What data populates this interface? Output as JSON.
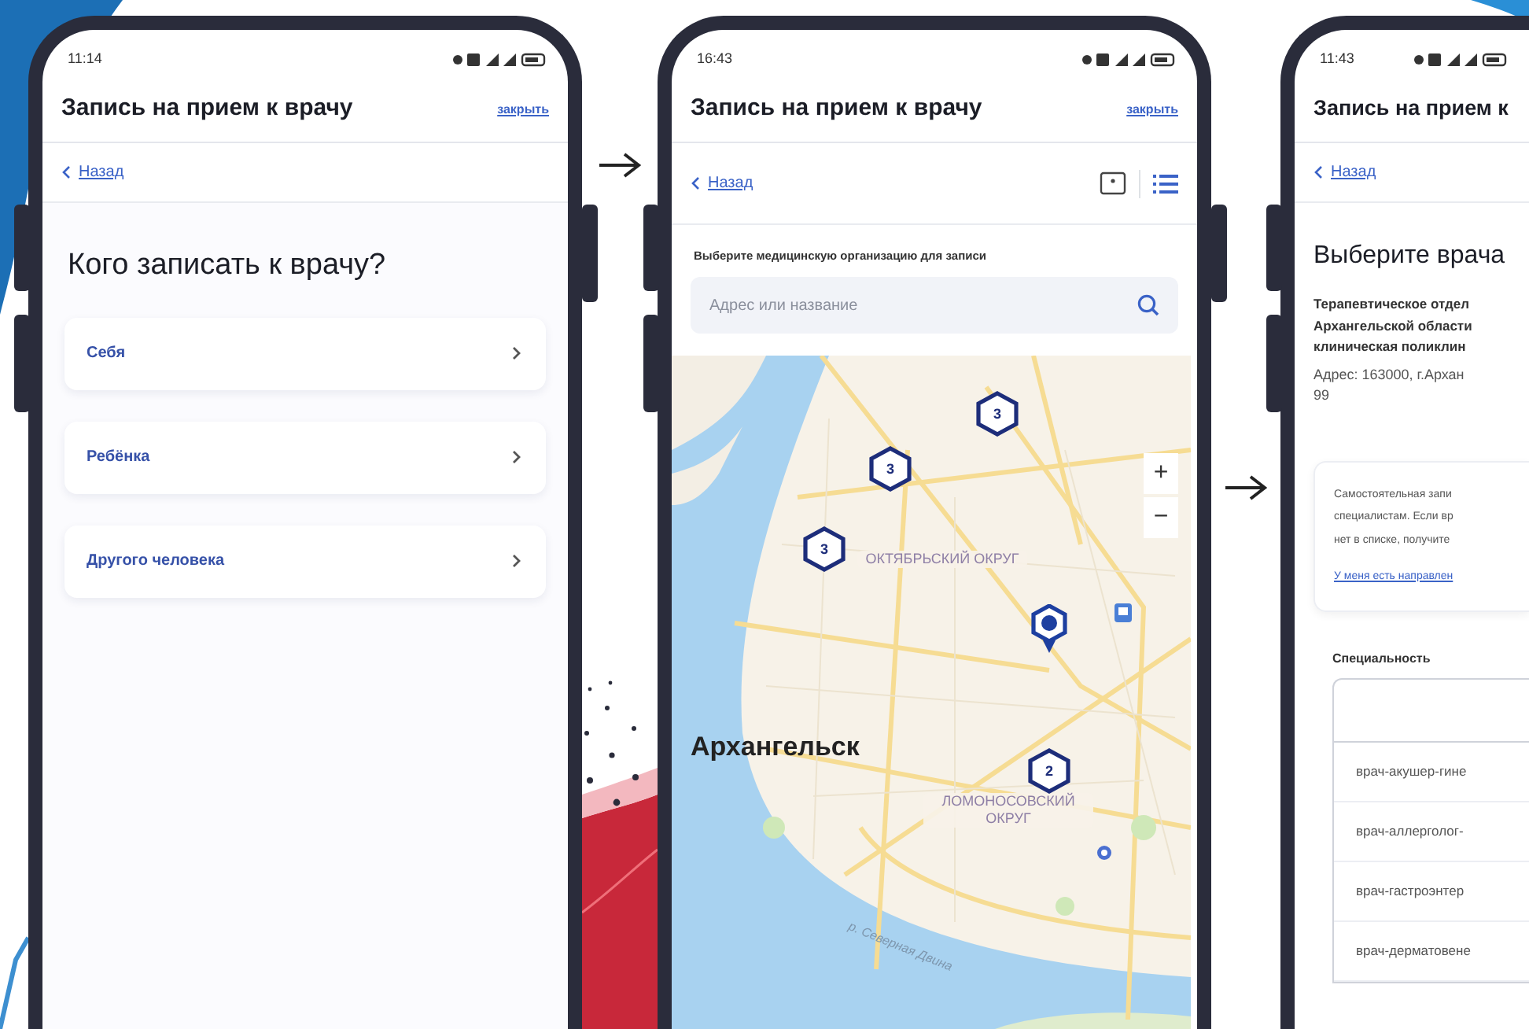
{
  "phones": [
    {
      "kind": "who",
      "status_time": "11:14",
      "title": "Запись на прием к врачу",
      "close": "закрыть",
      "back": "Назад",
      "heading": "Кого записать к врачу?",
      "options": [
        {
          "label": "Себя"
        },
        {
          "label": "Ребёнка"
        },
        {
          "label": "Другого человека"
        }
      ]
    },
    {
      "kind": "map",
      "status_time": "16:43",
      "title": "Запись на прием к врачу",
      "close": "закрыть",
      "back": "Назад",
      "prompt": "Выберите медицинскую организацию для записи",
      "search": {
        "placeholder": "Адрес или название"
      },
      "map": {
        "city": "Архангельск",
        "districts": [
          "ОКТЯБРЬСКИЙ ОКРУГ",
          "ЛОМОНОСОВСКИЙ ОКРУГ"
        ],
        "river": "р. Северная Двина",
        "clusters": [
          {
            "count": "3"
          },
          {
            "count": "3"
          },
          {
            "count": "3"
          },
          {
            "count": "2"
          }
        ],
        "zoom_in": "+",
        "zoom_out": "−"
      }
    },
    {
      "kind": "doctor",
      "status_time": "11:43",
      "title": "Запись на прием к",
      "back": "Назад",
      "heading": "Выберите врача",
      "org_lines": [
        "Терапевтическое отдел",
        "Архангельской области",
        "клиническая поликлин"
      ],
      "address_lines": [
        "Адрес: 163000, г.Архан",
        "99"
      ],
      "notice_lines": [
        "Самостоятельная запи",
        "специалистам. Если вр",
        "нет в списке, получите"
      ],
      "referral_link": "У меня есть направлен",
      "table_label": "Специальность",
      "rows": [
        "врач-акушер-гине",
        "врач-аллерголог-",
        "врач-гастроэнтер",
        "врач-дерматовене"
      ]
    }
  ]
}
